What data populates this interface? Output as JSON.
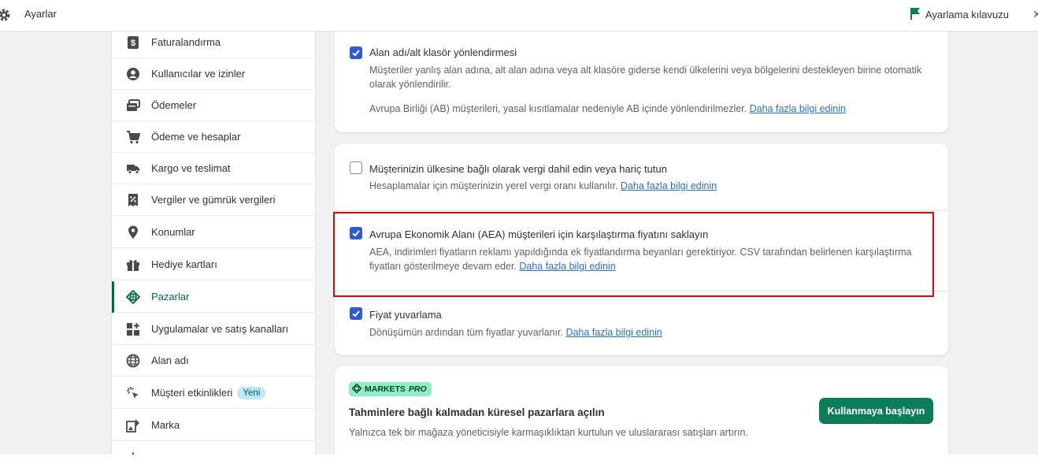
{
  "topbar": {
    "title": "Ayarlar",
    "guide_label": "Ayarlama kılavuzu",
    "close_glyph": "✕"
  },
  "sidebar": {
    "items": [
      {
        "label": "Faturalandırma",
        "icon": "billing-icon"
      },
      {
        "label": "Kullanıcılar ve izinler",
        "icon": "user-icon"
      },
      {
        "label": "Ödemeler",
        "icon": "payments-icon"
      },
      {
        "label": "Ödeme ve hesaplar",
        "icon": "cart-icon"
      },
      {
        "label": "Kargo ve teslimat",
        "icon": "truck-icon"
      },
      {
        "label": "Vergiler ve gümrük vergileri",
        "icon": "tax-icon"
      },
      {
        "label": "Konumlar",
        "icon": "location-icon"
      },
      {
        "label": "Hediye kartları",
        "icon": "gift-icon"
      },
      {
        "label": "Pazarlar",
        "icon": "globe-icon",
        "active": true
      },
      {
        "label": "Uygulamalar ve satış kanalları",
        "icon": "apps-icon"
      },
      {
        "label": "Alan adı",
        "icon": "domain-icon"
      },
      {
        "label": "Müşteri etkinlikleri",
        "icon": "cursor-click-icon",
        "badge": "Yeni"
      },
      {
        "label": "Marka",
        "icon": "brand-icon"
      }
    ]
  },
  "card1": {
    "option_title": "Alan adı/alt klasör yönlendirmesi",
    "checked": true,
    "desc": "Müşteriler yanlış alan adına, alt alan adına veya alt klasöre giderse kendi ülkelerini veya bölgelerini destekleyen birine otomatik olarak yönlendirilir.",
    "note": "Avrupa Birliği (AB) müşterileri, yasal kısıtlamalar nedeniyle AB içinde yönlendirilmezler.",
    "link": "Daha fazla bilgi edinin"
  },
  "card2": {
    "options": [
      {
        "title": "Müşterinizin ülkesine bağlı olarak vergi dahil edin veya hariç tutun",
        "checked": false,
        "desc": "Hesaplamalar için müşterinizin yerel vergi oranı kullanılır.",
        "link": "Daha fazla bilgi edinin"
      },
      {
        "title": "Avrupa Ekonomik Alanı (AEA) müşterileri için karşılaştırma fiyatını saklayın",
        "checked": true,
        "desc": "AEA, indirimleri fiyatların reklamı yapıldığında ek fiyatlandırma beyanları gerektiriyor. CSV tarafından belirlenen karşılaştırma fiyatları gösterilmeye devam eder.",
        "link": "Daha fazla bilgi edinin"
      },
      {
        "title": "Fiyat yuvarlama",
        "checked": true,
        "desc": "Dönüşümün ardından tüm fiyatlar yuvarlanır.",
        "link": "Daha fazla bilgi edinin"
      }
    ]
  },
  "markets_pro": {
    "badge_main": "MARKETS",
    "badge_pro": "PRO",
    "title": "Tahminlere bağlı kalmadan küresel pazarlara açılın",
    "desc": "Yalnızca tek bir mağaza yöneticisiyle karmaşıklıktan kurtulun ve uluslararası satışları artırın.",
    "button": "Kullanmaya başlayın"
  },
  "colors": {
    "accent_green": "#00694b",
    "checkbox_blue": "#2f5bd2",
    "highlight_red": "#e10600",
    "badge_blue_bg": "#bde9f8",
    "markets_badge_bg": "#8eefc6",
    "cta_green": "#0c7c59"
  }
}
